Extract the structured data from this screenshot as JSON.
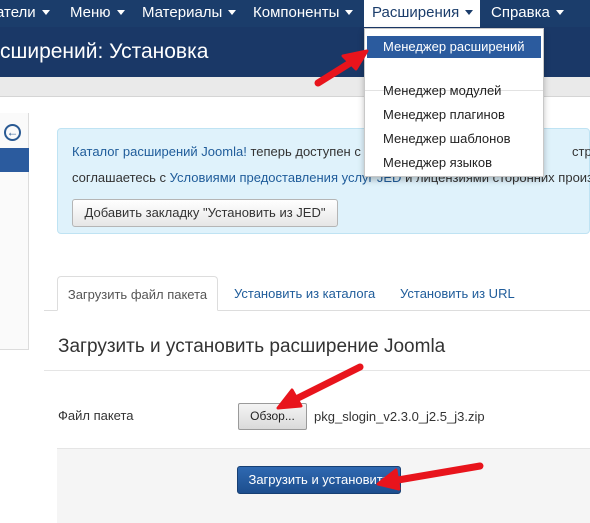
{
  "navbar": {
    "items": [
      {
        "label": "атели"
      },
      {
        "label": "Меню"
      },
      {
        "label": "Материалы"
      },
      {
        "label": "Компоненты"
      },
      {
        "label": "Расширения"
      },
      {
        "label": "Справка"
      }
    ]
  },
  "header": {
    "title": "сширений: Установка"
  },
  "dropdown": {
    "items": [
      {
        "label": "Менеджер расширений"
      },
      {
        "label": "Менеджер модулей"
      },
      {
        "label": "Менеджер плагинов"
      },
      {
        "label": "Менеджер шаблонов"
      },
      {
        "label": "Менеджер языков"
      }
    ]
  },
  "alert": {
    "line1_link": "Каталог расширений Joomla!",
    "line1_text": " теперь доступен с",
    "line1_tail": "стран",
    "line2_text": "соглашаетесь с ",
    "line2_link": "Условиями предоставления услуг JED",
    "line2_tail": " и лицензиями сторонних произ",
    "button_label": "Добавить закладку \"Установить из JED\""
  },
  "tabs": [
    {
      "label": "Загрузить файл пакета",
      "active": true
    },
    {
      "label": "Установить из каталога",
      "active": false
    },
    {
      "label": "Установить из URL",
      "active": false
    }
  ],
  "main": {
    "section_title": "Загрузить и установить расширение Joomla",
    "file_label": "Файл пакета",
    "browse_label": "Обзор...",
    "file_name": "pkg_slogin_v2.3.0_j2.5_j3.zip",
    "upload_label": "Загрузить и установить"
  },
  "colors": {
    "navbar": "#1b3d6b",
    "accent": "#2b5b9e",
    "annotation": "#e8141c"
  }
}
